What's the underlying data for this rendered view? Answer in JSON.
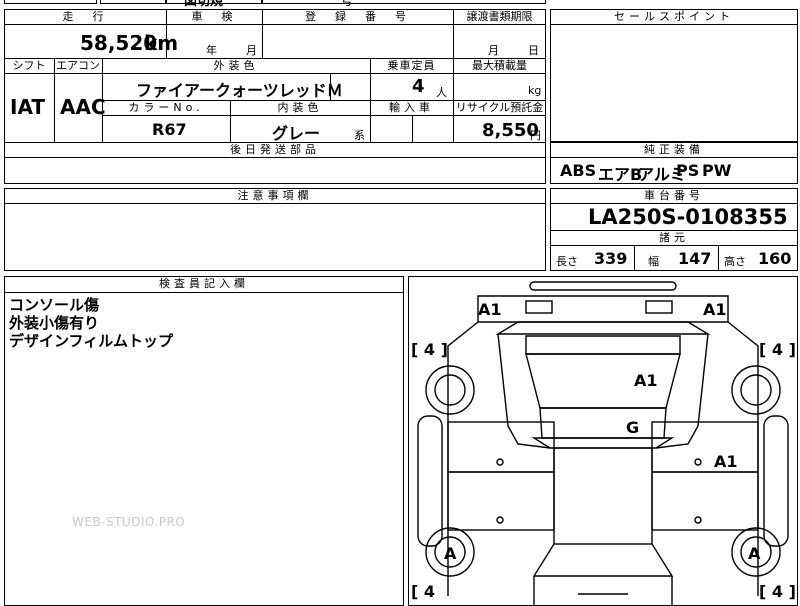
{
  "top_strip": {
    "partial_1": "図切規",
    "partial_2": "号"
  },
  "headers": {
    "mileage": "走　行",
    "inspection": "車　検",
    "registration": "登　録　番　号",
    "transfer_deadline": "譲渡書類期限",
    "sales_point": "セールスポイント",
    "shift": "シフト",
    "aircon": "エアコン",
    "exterior_color": "外装色",
    "capacity": "乗車定員",
    "max_load": "最大積載量",
    "color_no": "カラーNo.",
    "interior_color": "内装色",
    "import": "輸入車",
    "recycle": "リサイクル預託金",
    "later_parts": "後日発送部品",
    "genuine_equipment": "純正装備",
    "notes": "注意事項欄",
    "chassis_no": "車台番号",
    "specs": "諸元",
    "inspector_notes": "検査員記入欄"
  },
  "values": {
    "mileage": "58,520",
    "mileage_unit": "km",
    "inspection_year": "年",
    "inspection_month": "月",
    "transfer_month": "月",
    "transfer_day": "日",
    "shift": "IAT",
    "aircon": "AAC",
    "exterior_color": "ファイアークォーツレッドＭ",
    "capacity": "4",
    "capacity_unit": "人",
    "load_unit": "kg",
    "color_no": "R67",
    "interior_color": "グレー",
    "interior_suffix": "系",
    "recycle_amount": "8,550",
    "recycle_unit": "円",
    "equipment": [
      "ABS",
      "エアB",
      "アルミ",
      "PS",
      "PW"
    ],
    "chassis_no": "LA250S-0108355",
    "length_label": "長さ",
    "length": "339",
    "width_label": "幅",
    "width": "147",
    "height_label": "高さ",
    "height": "160"
  },
  "inspector_lines": [
    "コンソール傷",
    "外装小傷有り",
    "デザインフィルムトップ"
  ],
  "watermark": "WEB-STUDIO.PRO",
  "diagram_marks": {
    "front_left": "A1",
    "front_right": "A1",
    "roof": "A1",
    "glass": "G",
    "right_side": "A1",
    "rear_left_wheel": "A",
    "rear_right_wheel": "A",
    "tire_fl": "[ 4 ]",
    "tire_fr": "[ 4 ]",
    "tire_rl": "[ 4",
    "tire_rr": "[ 4 ]"
  }
}
